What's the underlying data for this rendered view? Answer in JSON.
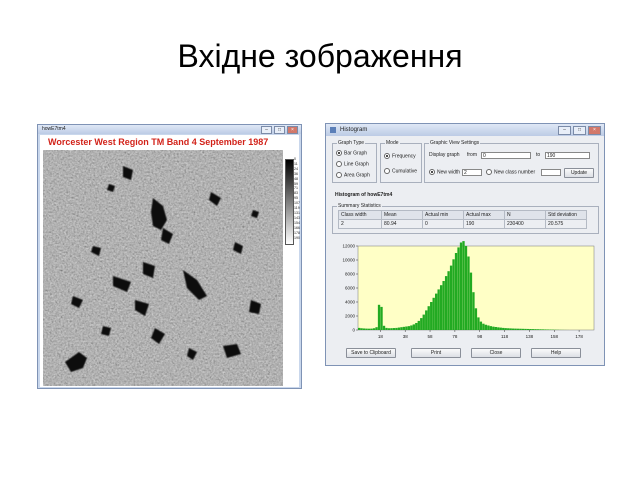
{
  "slide": {
    "title": "Вхідне зображення"
  },
  "image_window": {
    "window_title": "howE7tm4",
    "heading": "Worcester West Region TM Band 4 September 1987",
    "colorbar_labels": [
      "0",
      "11",
      "24",
      "36",
      "48",
      "59",
      "71",
      "83",
      "95",
      "107",
      "119",
      "131",
      "143",
      "154",
      "166",
      "178",
      "190"
    ]
  },
  "histogram_window": {
    "title": "Histogram",
    "graph_type": {
      "label": "Graph Type",
      "options": [
        "Bar Graph",
        "Line Graph",
        "Area Graph"
      ],
      "selected": 0
    },
    "mode": {
      "label": "Mode",
      "options": [
        "Frequency",
        "Cumulative"
      ],
      "selected": 0
    },
    "view_settings": {
      "label": "Graphic View Settings",
      "display_graph_label": "Display graph",
      "from_label": "from",
      "from_value": "0",
      "to_label": "to",
      "to_value": "190",
      "new_width_label": "New width",
      "new_width_value": "2",
      "new_class_label": "New class number",
      "new_class_value": "",
      "width_selected": true,
      "update_label": "Update"
    },
    "histogram_title": "Histogram of howE7tm4",
    "summary_label": "Summary Statistics",
    "stats": {
      "headers": [
        "Class width",
        "Mean",
        "Actual min",
        "Actual max",
        "N",
        "Std deviation"
      ],
      "values": [
        "2",
        "80.94",
        "0",
        "190",
        "230400",
        "20.575"
      ]
    },
    "buttons": {
      "save": "Save to Clipboard",
      "print": "Print",
      "close": "Close",
      "help": "Help"
    }
  },
  "colors": {
    "bar": "#22aa22",
    "plot_bg": "#ffffc6",
    "heading": "#d2231a",
    "titlebar": "#c9d7ec"
  },
  "chart_data": {
    "type": "bar",
    "xlabel": "",
    "ylabel": "",
    "xlim": [
      0,
      190
    ],
    "ylim": [
      0,
      12000
    ],
    "yticks": [
      0,
      2000,
      4000,
      6000,
      8000,
      10000,
      12000
    ],
    "xticks": [
      18,
      38,
      58,
      78,
      98,
      118,
      138,
      158,
      178
    ],
    "x": [
      0,
      2,
      4,
      6,
      8,
      10,
      12,
      14,
      16,
      18,
      20,
      22,
      24,
      26,
      28,
      30,
      32,
      34,
      36,
      38,
      40,
      42,
      44,
      46,
      48,
      50,
      52,
      54,
      56,
      58,
      60,
      62,
      64,
      66,
      68,
      70,
      72,
      74,
      76,
      78,
      80,
      82,
      84,
      86,
      88,
      90,
      92,
      94,
      96,
      98,
      100,
      102,
      104,
      106,
      108,
      110,
      112,
      114,
      116,
      118,
      120,
      122,
      124,
      126,
      128,
      130,
      132,
      134,
      136,
      138,
      140,
      142,
      144,
      146,
      148,
      150,
      152,
      154,
      156,
      158,
      160,
      162,
      164,
      166,
      168,
      170,
      172,
      174,
      176,
      178,
      180,
      182,
      184,
      186,
      188,
      190
    ],
    "values": [
      300,
      250,
      220,
      200,
      190,
      200,
      250,
      400,
      3600,
      3300,
      600,
      300,
      250,
      260,
      280,
      300,
      350,
      400,
      450,
      500,
      550,
      650,
      800,
      1000,
      1300,
      1700,
      2200,
      2800,
      3400,
      4000,
      4600,
      5200,
      5800,
      6400,
      7000,
      7700,
      8400,
      9200,
      10100,
      11000,
      11800,
      12500,
      12700,
      12000,
      10500,
      8200,
      5400,
      3100,
      1800,
      1200,
      900,
      750,
      650,
      550,
      480,
      430,
      380,
      340,
      300,
      270,
      250,
      230,
      210,
      200,
      190,
      180,
      170,
      160,
      150,
      140,
      130,
      120,
      110,
      100,
      90,
      80,
      70,
      60,
      50,
      40,
      30,
      20,
      15,
      10,
      5,
      0,
      0,
      0,
      0,
      0,
      0,
      0,
      0,
      0,
      0,
      0
    ]
  }
}
